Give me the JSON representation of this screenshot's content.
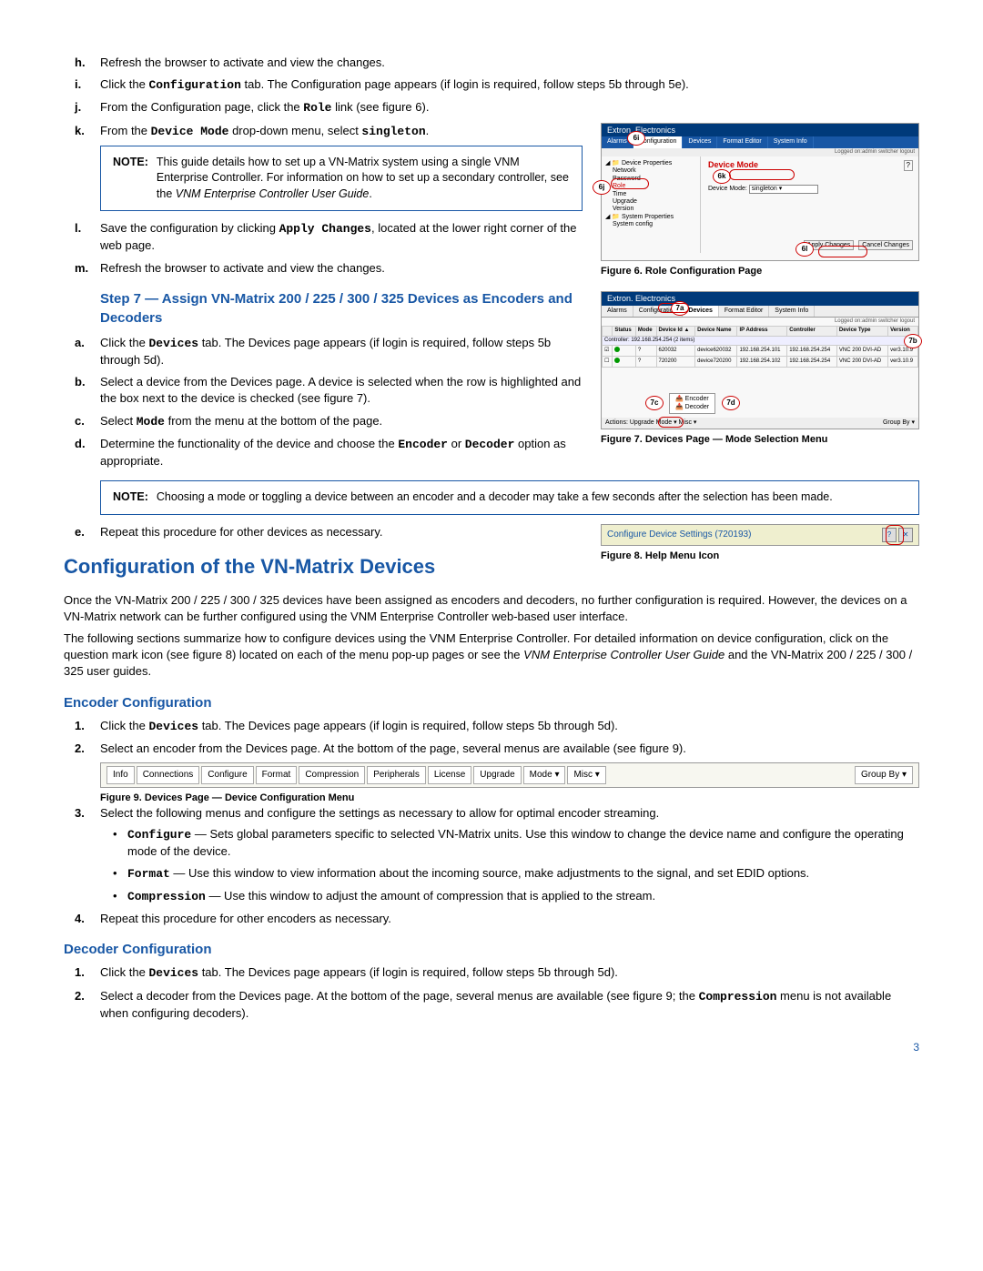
{
  "steps_hm": {
    "h": "Refresh the browser to activate and view the changes.",
    "i_pre": "Click the ",
    "i_code": "Configuration",
    "i_post": " tab. The Configuration page appears (if login is required, follow steps 5b through 5e).",
    "j_pre": "From the Configuration page, click the ",
    "j_code": "Role",
    "j_post": " link (see figure 6).",
    "k_pre": "From the ",
    "k_code1": "Device Mode",
    "k_mid": " drop-down menu, select ",
    "k_code2": "singleton",
    "k_post": ".",
    "note_label": "NOTE:",
    "note_text_pre": "This guide details how to set up a VN-Matrix system using a single VNM Enterprise Controller. For information on how to set up a secondary controller, see the ",
    "note_text_ital": "VNM Enterprise Controller User Guide",
    "note_text_post": ".",
    "l_pre": "Save the configuration by clicking ",
    "l_code": "Apply Changes",
    "l_post": ", located at the lower right corner of the web page.",
    "m": "Refresh the browser to activate and view the changes."
  },
  "fig6": {
    "brand": "Extron. Electronics",
    "tabs": [
      "Alarms",
      "Configuration",
      "Devices",
      "Format Editor",
      "System Info"
    ],
    "login": "Logged on:admin  switcher  logout",
    "tree": {
      "root": "Device Properties",
      "items": [
        "Network",
        "Password",
        "Role",
        "Time",
        "Upgrade",
        "Version"
      ],
      "root2": "System Properties",
      "items2": [
        "System config"
      ]
    },
    "panel_title": "Device Mode",
    "field_label": "Device Mode:",
    "field_value": "singleton",
    "btn_apply": "Apply Changes",
    "btn_cancel": "Cancel Changes",
    "help": "?",
    "callouts": {
      "top": "6i",
      "left": "6j",
      "mid": "6k",
      "bottom": "6l"
    },
    "caption": "Figure 6. Role Configuration Page"
  },
  "step7": {
    "heading": "Step 7 — Assign VN-Matrix 200 / 225 / 300 / 325 Devices as Encoders and Decoders",
    "a_pre": "Click the ",
    "a_code": "Devices",
    "a_post": " tab. The Devices page appears (if login is required, follow steps 5b through 5d).",
    "b": "Select a device from the Devices page. A device is selected when the row is highlighted and the box next to the device is checked (see figure 7).",
    "c_pre": "Select ",
    "c_code": "Mode",
    "c_post": " from the menu at the bottom of the page.",
    "d_pre": "Determine the functionality of the device and choose the ",
    "d_code1": "Encoder",
    "d_mid": " or ",
    "d_code2": "Decoder",
    "d_post": " option as appropriate.",
    "note_label": "NOTE:",
    "note_text": "Choosing a mode or toggling a device between an encoder and a decoder may take a few seconds after the selection has been made.",
    "e": "Repeat this procedure for other devices as necessary."
  },
  "fig7": {
    "brand": "Extron. Electronics",
    "tabs": [
      "Alarms",
      "Configuration",
      "Devices",
      "Format Editor",
      "System Info"
    ],
    "login": "Logged on:admin  switcher  logout",
    "headers": [
      "",
      "Status",
      "Mode",
      "Device Id ▲",
      "Device Name",
      "IP Address",
      "Controller",
      "Device Type",
      "Version"
    ],
    "group": "Controller: 192.168.254.254 (2 items)",
    "rows": [
      [
        "",
        "●",
        "?",
        "620032",
        "device620032",
        "192.168.254.101",
        "192.168.254.254",
        "VNC 200 DVI-AD",
        "ver3.10.9"
      ],
      [
        "",
        "●",
        "?",
        "720200",
        "device720200",
        "192.168.254.102",
        "192.168.254.254",
        "VNC 200 DVI-AD",
        "ver3.10.9"
      ]
    ],
    "mode_menu": [
      "Encoder",
      "Decoder"
    ],
    "footer_left": "Actions:  Upgrade  Mode ▾  Misc ▾",
    "footer_right": "Group By ▾",
    "callouts": {
      "top": "7a",
      "right": "7b",
      "menu_left": "7c",
      "menu_right": "7d"
    },
    "caption": "Figure 7. Devices Page — Mode Selection Menu"
  },
  "config_section": {
    "heading": "Configuration of the VN-Matrix Devices",
    "p1": "Once the VN-Matrix 200 / 225 / 300 / 325 devices have been assigned as encoders and decoders, no further configuration is required. However, the devices on a VN-Matrix network can be further configured using the VNM Enterprise Controller web-based user interface.",
    "p2_pre": "The following sections summarize how to configure devices using the VNM Enterprise Controller. For detailed information on device configuration, click on the question mark icon (see figure 8) located on each of the menu pop-up pages or see the ",
    "p2_ital": "VNM Enterprise Controller User Guide",
    "p2_post": " and the VN-Matrix 200 / 225 / 300 / 325 user guides."
  },
  "fig8": {
    "title": "Configure Device Settings (720193)",
    "caption": "Figure 8. Help Menu Icon"
  },
  "encoder": {
    "heading": "Encoder Configuration",
    "s1_pre": "Click the ",
    "s1_code": "Devices",
    "s1_post": " tab. The Devices page appears (if login is required, follow steps 5b through 5d).",
    "s2": "Select an encoder from the Devices page. At the bottom of the page, several menus are available (see figure 9).",
    "s3": "Select the following menus and configure the settings as necessary to allow for optimal encoder streaming.",
    "b1_code": "Configure",
    "b1_text": " — Sets global parameters specific to selected VN-Matrix units. Use this window to change the device name and configure the operating mode of the device.",
    "b2_code": "Format",
    "b2_text": " — Use this window to view information about the incoming source, make adjustments to the signal, and set EDID options.",
    "b3_code": "Compression",
    "b3_text": " — Use this window to adjust the amount of compression that is applied to the stream.",
    "s4": "Repeat this procedure for other encoders as necessary."
  },
  "fig9": {
    "buttons": [
      "Info",
      "Connections",
      "Configure",
      "Format",
      "Compression",
      "Peripherals",
      "License",
      "Upgrade",
      "Mode ▾",
      "Misc ▾"
    ],
    "right": "Group By ▾",
    "caption": "Figure 9. Devices Page — Device Configuration Menu"
  },
  "decoder": {
    "heading": "Decoder Configuration",
    "s1_pre": "Click the ",
    "s1_code": "Devices",
    "s1_post": " tab. The Devices page appears (if login is required, follow steps 5b through 5d).",
    "s2_pre": "Select a decoder from the Devices page. At the bottom of the page, several menus are available (see figure 9; the ",
    "s2_code": "Compression",
    "s2_post": " menu is not available when configuring decoders)."
  },
  "page_number": "3"
}
